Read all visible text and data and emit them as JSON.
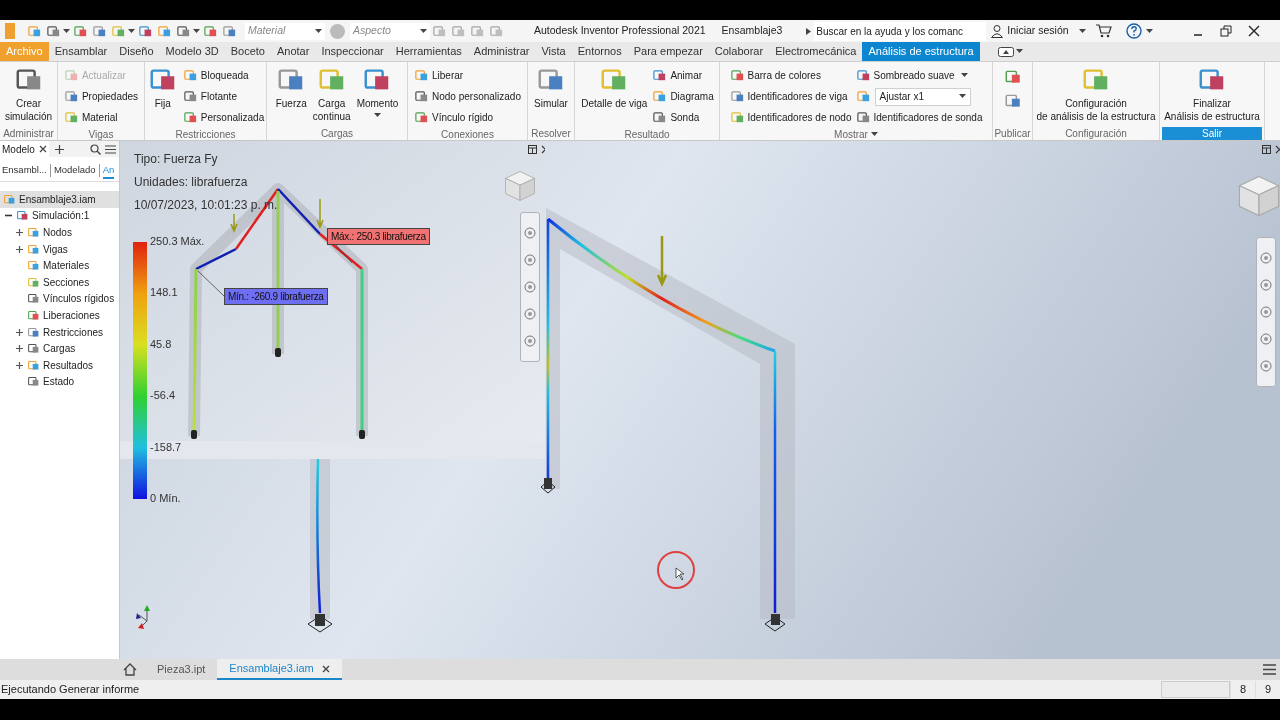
{
  "title_bar": {
    "material": "Material",
    "appearance": "Aspecto",
    "app_title": "Autodesk Inventor Professional 2021",
    "document": "Ensamblaje3",
    "search_placeholder": "Buscar en la ayuda y los comanc",
    "sign_in": "Iniciar sesión"
  },
  "ribbon_tabs": [
    {
      "label": "Archivo",
      "kind": "file",
      "selected": false
    },
    {
      "label": "Ensamblar",
      "kind": "tab",
      "selected": false
    },
    {
      "label": "Diseño",
      "kind": "tab",
      "selected": false
    },
    {
      "label": "Modelo 3D",
      "kind": "tab",
      "selected": false
    },
    {
      "label": "Boceto",
      "kind": "tab",
      "selected": false
    },
    {
      "label": "Anotar",
      "kind": "tab",
      "selected": false
    },
    {
      "label": "Inspeccionar",
      "kind": "tab",
      "selected": false
    },
    {
      "label": "Herramientas",
      "kind": "tab",
      "selected": false
    },
    {
      "label": "Administrar",
      "kind": "tab",
      "selected": false
    },
    {
      "label": "Vista",
      "kind": "tab",
      "selected": false
    },
    {
      "label": "Entornos",
      "kind": "tab",
      "selected": false
    },
    {
      "label": "Para empezar",
      "kind": "tab",
      "selected": false
    },
    {
      "label": "Colaborar",
      "kind": "tab",
      "selected": false
    },
    {
      "label": "Electromecánica",
      "kind": "tab",
      "selected": false
    },
    {
      "label": "Análisis de estructura",
      "kind": "tab",
      "selected": true
    }
  ],
  "ribbon_panels": [
    {
      "title": "Administrar",
      "highlighted": false,
      "menu": false,
      "columns": [
        [
          {
            "label": "Crear\nsimulación",
            "kind": "large",
            "disabled": false,
            "menu": false
          }
        ]
      ]
    },
    {
      "title": "Vigas",
      "highlighted": false,
      "menu": false,
      "columns": [
        [
          {
            "label": "Actualizar",
            "kind": "small",
            "disabled": true,
            "menu": false
          },
          {
            "label": "Propiedades",
            "kind": "small",
            "disabled": false,
            "menu": false
          },
          {
            "label": "Material",
            "kind": "small",
            "disabled": false,
            "menu": false
          }
        ]
      ]
    },
    {
      "title": "Restricciones",
      "highlighted": false,
      "menu": false,
      "columns": [
        [
          {
            "label": "Fija",
            "kind": "large",
            "disabled": false,
            "menu": false
          }
        ],
        [
          {
            "label": "Bloqueada",
            "kind": "small",
            "disabled": false,
            "menu": false
          },
          {
            "label": "Flotante",
            "kind": "small",
            "disabled": false,
            "menu": false
          },
          {
            "label": "Personalizada",
            "kind": "small",
            "disabled": false,
            "menu": false
          }
        ]
      ]
    },
    {
      "title": "Cargas",
      "highlighted": false,
      "menu": false,
      "columns": [
        [
          {
            "label": "Fuerza",
            "kind": "large",
            "disabled": false,
            "menu": false
          }
        ],
        [
          {
            "label": "Carga\ncontinua",
            "kind": "large",
            "disabled": false,
            "menu": false
          }
        ],
        [
          {
            "label": "Momento",
            "kind": "large",
            "disabled": false,
            "menu": true
          }
        ]
      ]
    },
    {
      "title": "Conexiones",
      "highlighted": false,
      "menu": false,
      "columns": [
        [
          {
            "label": "Liberar",
            "kind": "small",
            "disabled": false,
            "menu": false
          },
          {
            "label": "Nodo personalizado",
            "kind": "small",
            "disabled": false,
            "menu": false
          },
          {
            "label": "Vínculo rígido",
            "kind": "small",
            "disabled": false,
            "menu": false
          }
        ]
      ]
    },
    {
      "title": "Resolver",
      "highlighted": false,
      "menu": false,
      "columns": [
        [
          {
            "label": "Simular",
            "kind": "large",
            "disabled": false,
            "menu": false
          }
        ]
      ]
    },
    {
      "title": "Resultado",
      "highlighted": false,
      "menu": false,
      "columns": [
        [
          {
            "label": "Detalle de viga",
            "kind": "large",
            "disabled": false,
            "menu": false
          }
        ],
        [
          {
            "label": "Animar",
            "kind": "small",
            "disabled": false,
            "menu": false
          },
          {
            "label": "Diagrama",
            "kind": "small",
            "disabled": false,
            "menu": false
          },
          {
            "label": "Sonda",
            "kind": "small",
            "disabled": false,
            "menu": false
          }
        ]
      ]
    },
    {
      "title": "Mostrar",
      "highlighted": false,
      "menu": true,
      "columns": [
        [
          {
            "label": "Barra de colores",
            "kind": "small",
            "disabled": false,
            "menu": false
          },
          {
            "label": "Identificadores de viga",
            "kind": "small",
            "disabled": false,
            "menu": false
          },
          {
            "label": "Identificadores de nodo",
            "kind": "small",
            "disabled": false,
            "menu": false
          }
        ],
        [
          {
            "label": "Sombreado suave",
            "kind": "small",
            "disabled": false,
            "menu": true
          },
          {
            "label": "Ajustar x1",
            "kind": "combo",
            "disabled": false,
            "menu": true
          },
          {
            "label": "Identificadores de sonda",
            "kind": "small",
            "disabled": false,
            "menu": false
          }
        ]
      ]
    },
    {
      "title": "Publicar",
      "highlighted": false,
      "menu": false,
      "columns": [
        [
          {
            "kind": "icon",
            "disabled": false,
            "menu": false
          },
          {
            "kind": "icon",
            "disabled": false,
            "menu": false
          }
        ]
      ]
    },
    {
      "title": "Configuración",
      "highlighted": false,
      "menu": false,
      "columns": [
        [
          {
            "label": "Configuración\nde análisis de la estructura",
            "kind": "large",
            "disabled": false,
            "menu": false
          }
        ]
      ]
    },
    {
      "title": "Salir",
      "highlighted": true,
      "menu": false,
      "columns": [
        [
          {
            "label": "Finalizar\nAnálisis de estructura",
            "kind": "large",
            "disabled": false,
            "menu": false
          }
        ]
      ]
    }
  ],
  "browser": {
    "tabs": [
      {
        "label": "Modelo",
        "selected": true
      }
    ],
    "subtabs": [
      {
        "label": "Ensambl...",
        "selected": false
      },
      {
        "label": "Modelado",
        "selected": false
      },
      {
        "label": "An",
        "selected": true
      }
    ],
    "tree": [
      {
        "label": "Ensamblaje3.iam",
        "kind": "root",
        "selected": true,
        "children": [
          {
            "label": "Simulación:1",
            "kind": "group",
            "selected": false,
            "expanded": true,
            "children": [
              {
                "label": "Nodos",
                "kind": "group",
                "selected": false,
                "expanded": false
              },
              {
                "label": "Vigas",
                "kind": "group",
                "selected": false,
                "expanded": false
              },
              {
                "label": "Materiales",
                "kind": "leaf",
                "selected": false,
                "expanded": false
              },
              {
                "label": "Secciones",
                "kind": "leaf",
                "selected": false,
                "expanded": false
              },
              {
                "label": "Vínculos rígidos",
                "kind": "leaf",
                "selected": false,
                "expanded": false
              },
              {
                "label": "Liberaciones",
                "kind": "leaf",
                "selected": false,
                "expanded": false
              },
              {
                "label": "Restricciones",
                "kind": "group",
                "selected": false,
                "expanded": false
              },
              {
                "label": "Cargas",
                "kind": "group",
                "selected": false,
                "expanded": false
              },
              {
                "label": "Resultados",
                "kind": "group",
                "selected": false,
                "expanded": false
              },
              {
                "label": "Estado",
                "kind": "leaf",
                "selected": false,
                "expanded": false
              }
            ]
          }
        ]
      }
    ]
  },
  "viewport": {
    "result_info": [
      "Tipo: Fuerza Fy",
      "Unidades: librafuerza",
      "10/07/2023, 10:01:23 p. m."
    ],
    "scale_labels": [
      "250.3 Máx.",
      "148.1",
      "45.8",
      "-56.4",
      "-158.7",
      "0 Mín."
    ],
    "callouts": [
      {
        "text": "Máx.: 250.3 librafuerza",
        "color": "#f07272"
      },
      {
        "text": "Mín.: -260.9 librafuerza",
        "color": "#6e6ef2"
      }
    ]
  },
  "document_tabs": [
    {
      "label": "Pieza3.ipt",
      "selected": false,
      "closable": false
    },
    {
      "label": "Ensamblaje3.iam",
      "selected": true,
      "closable": true
    }
  ],
  "status_bar": {
    "message": "Ejecutando Generar informe",
    "fields": [
      "8",
      "9"
    ]
  }
}
